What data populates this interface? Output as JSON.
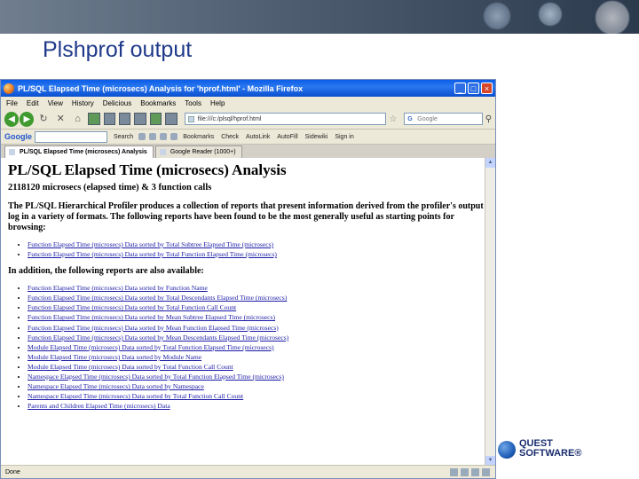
{
  "slide": {
    "title": "Plshprof output"
  },
  "browser": {
    "window_title": "PL/SQL Elapsed Time (microsecs) Analysis for 'hprof.html' - Mozilla Firefox",
    "menu": [
      "File",
      "Edit",
      "View",
      "History",
      "Delicious",
      "Bookmarks",
      "Tools",
      "Help"
    ],
    "url": "file:///c:/plsql/hprof.html",
    "search_placeholder": "Google",
    "google_bar": {
      "logo": "Google",
      "items": [
        "Search",
        "Bookmarks",
        "Check",
        "AutoLink",
        "AutoFill",
        "Sidewiki",
        "Sign in"
      ]
    },
    "tabs": [
      {
        "label": "PL/SQL Elapsed Time (microsecs) Analysis"
      },
      {
        "label": "Google Reader (1000+)"
      }
    ],
    "status": "Done"
  },
  "page": {
    "heading": "PL/SQL Elapsed Time (microsecs) Analysis",
    "summary": "2118120 microsecs (elapsed time) & 3 function calls",
    "intro": "The PL/SQL Hierarchical Profiler produces a collection of reports that present information derived from the profiler's output log in a variety of formats. The following reports have been found to be the most generally useful as starting points for browsing:",
    "primary_links": [
      "Function Elapsed Time (microsecs) Data sorted by Total Subtree Elapsed Time (microsecs)",
      "Function Elapsed Time (microsecs) Data sorted by Total Function Elapsed Time (microsecs)"
    ],
    "additional_heading": "In addition, the following reports are also available:",
    "additional_links": [
      "Function Elapsed Time (microsecs) Data sorted by Function Name",
      "Function Elapsed Time (microsecs) Data sorted by Total Descendants Elapsed Time (microsecs)",
      "Function Elapsed Time (microsecs) Data sorted by Total Function Call Count",
      "Function Elapsed Time (microsecs) Data sorted by Mean Subtree Elapsed Time (microsecs)",
      "Function Elapsed Time (microsecs) Data sorted by Mean Function Elapsed Time (microsecs)",
      "Function Elapsed Time (microsecs) Data sorted by Mean Descendants Elapsed Time (microsecs)",
      "Module Elapsed Time (microsecs) Data sorted by Total Function Elapsed Time (microsecs)",
      "Module Elapsed Time (microsecs) Data sorted by Module Name",
      "Module Elapsed Time (microsecs) Data sorted by Total Function Call Count",
      "Namespace Elapsed Time (microsecs) Data sorted by Total Function Elapsed Time (microsecs)",
      "Namespace Elapsed Time (microsecs) Data sorted by Namespace",
      "Namespace Elapsed Time (microsecs) Data sorted by Total Function Call Count",
      "Parents and Children Elapsed Time (microsecs) Data"
    ]
  },
  "logo": {
    "line1": "QUEST",
    "line2": "SOFTWARE®"
  }
}
